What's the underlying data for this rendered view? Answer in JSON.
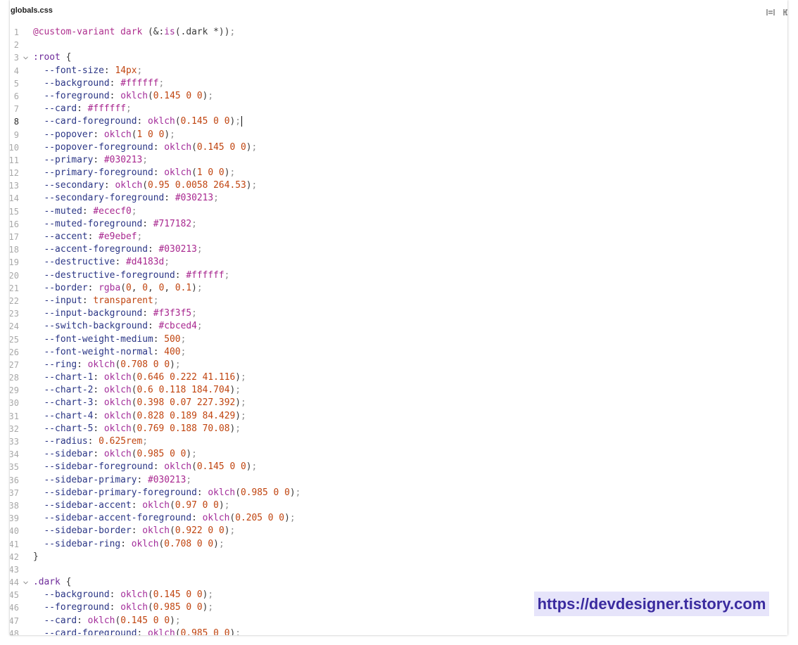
{
  "editor": {
    "file_name": "globals.css",
    "toolbar_icons": [
      "wrap-icon",
      "copy-icon"
    ],
    "active_line": 8,
    "cursor_line": 8,
    "syntax_colors": {
      "property": "#2a3585",
      "function": "#a32d9a",
      "hex": "#a8278f",
      "number": "#c0440f",
      "keyword": "#c0440f",
      "selector": "#6e2b9a",
      "at_rule": "#ae2f8e",
      "punctuation": "#3a3a3a",
      "semicolon": "#8e8e8e",
      "line_number": "#a8a8a8",
      "line_number_active": "#2b2b2b"
    }
  },
  "code": {
    "lines": [
      {
        "n": 1,
        "text": "@custom-variant dark (&:is(.dark *));"
      },
      {
        "n": 2,
        "text": ""
      },
      {
        "n": 3,
        "text": ":root {",
        "fold": true
      },
      {
        "n": 4,
        "text": "  --font-size: 14px;"
      },
      {
        "n": 5,
        "text": "  --background: #ffffff;"
      },
      {
        "n": 6,
        "text": "  --foreground: oklch(0.145 0 0);"
      },
      {
        "n": 7,
        "text": "  --card: #ffffff;"
      },
      {
        "n": 8,
        "text": "  --card-foreground: oklch(0.145 0 0);"
      },
      {
        "n": 9,
        "text": "  --popover: oklch(1 0 0);"
      },
      {
        "n": 10,
        "text": "  --popover-foreground: oklch(0.145 0 0);"
      },
      {
        "n": 11,
        "text": "  --primary: #030213;"
      },
      {
        "n": 12,
        "text": "  --primary-foreground: oklch(1 0 0);"
      },
      {
        "n": 13,
        "text": "  --secondary: oklch(0.95 0.0058 264.53);"
      },
      {
        "n": 14,
        "text": "  --secondary-foreground: #030213;"
      },
      {
        "n": 15,
        "text": "  --muted: #ececf0;"
      },
      {
        "n": 16,
        "text": "  --muted-foreground: #717182;"
      },
      {
        "n": 17,
        "text": "  --accent: #e9ebef;"
      },
      {
        "n": 18,
        "text": "  --accent-foreground: #030213;"
      },
      {
        "n": 19,
        "text": "  --destructive: #d4183d;"
      },
      {
        "n": 20,
        "text": "  --destructive-foreground: #ffffff;"
      },
      {
        "n": 21,
        "text": "  --border: rgba(0, 0, 0, 0.1);"
      },
      {
        "n": 22,
        "text": "  --input: transparent;"
      },
      {
        "n": 23,
        "text": "  --input-background: #f3f3f5;"
      },
      {
        "n": 24,
        "text": "  --switch-background: #cbced4;"
      },
      {
        "n": 25,
        "text": "  --font-weight-medium: 500;"
      },
      {
        "n": 26,
        "text": "  --font-weight-normal: 400;"
      },
      {
        "n": 27,
        "text": "  --ring: oklch(0.708 0 0);"
      },
      {
        "n": 28,
        "text": "  --chart-1: oklch(0.646 0.222 41.116);"
      },
      {
        "n": 29,
        "text": "  --chart-2: oklch(0.6 0.118 184.704);"
      },
      {
        "n": 30,
        "text": "  --chart-3: oklch(0.398 0.07 227.392);"
      },
      {
        "n": 31,
        "text": "  --chart-4: oklch(0.828 0.189 84.429);"
      },
      {
        "n": 32,
        "text": "  --chart-5: oklch(0.769 0.188 70.08);"
      },
      {
        "n": 33,
        "text": "  --radius: 0.625rem;"
      },
      {
        "n": 34,
        "text": "  --sidebar: oklch(0.985 0 0);"
      },
      {
        "n": 35,
        "text": "  --sidebar-foreground: oklch(0.145 0 0);"
      },
      {
        "n": 36,
        "text": "  --sidebar-primary: #030213;"
      },
      {
        "n": 37,
        "text": "  --sidebar-primary-foreground: oklch(0.985 0 0);"
      },
      {
        "n": 38,
        "text": "  --sidebar-accent: oklch(0.97 0 0);"
      },
      {
        "n": 39,
        "text": "  --sidebar-accent-foreground: oklch(0.205 0 0);"
      },
      {
        "n": 40,
        "text": "  --sidebar-border: oklch(0.922 0 0);"
      },
      {
        "n": 41,
        "text": "  --sidebar-ring: oklch(0.708 0 0);"
      },
      {
        "n": 42,
        "text": "}"
      },
      {
        "n": 43,
        "text": ""
      },
      {
        "n": 44,
        "text": ".dark {",
        "fold": true
      },
      {
        "n": 45,
        "text": "  --background: oklch(0.145 0 0);"
      },
      {
        "n": 46,
        "text": "  --foreground: oklch(0.985 0 0);"
      },
      {
        "n": 47,
        "text": "  --card: oklch(0.145 0 0);"
      },
      {
        "n": 48,
        "text": "  --card-foreground: oklch(0.985 0 0);"
      }
    ]
  },
  "watermark": {
    "text": "https://devdesigner.tistory.com",
    "color": "#3a2b9f",
    "background": "#e6e4fa"
  }
}
